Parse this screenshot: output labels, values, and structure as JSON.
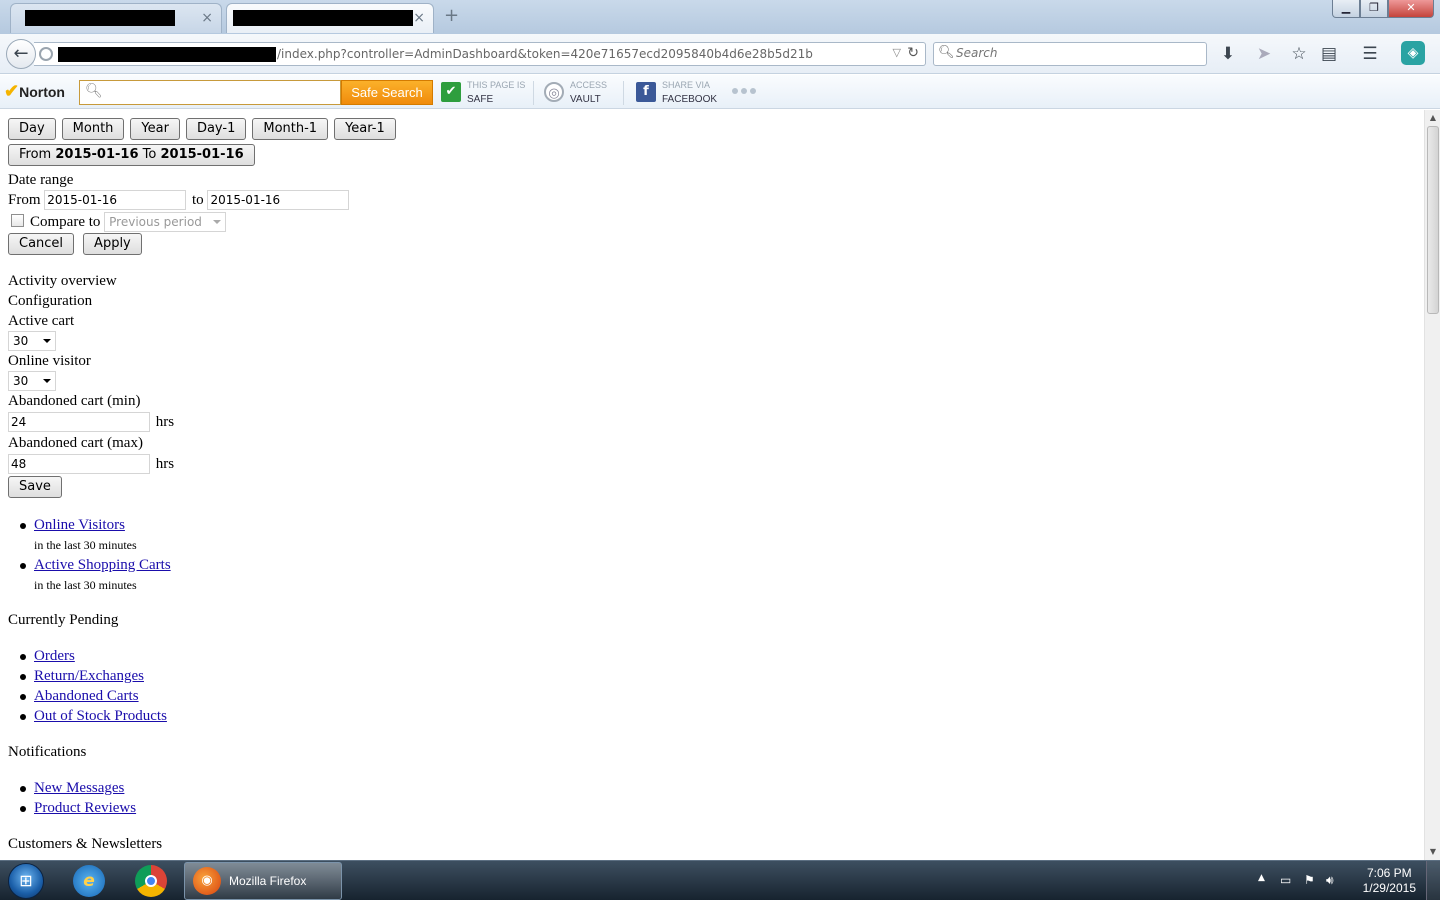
{
  "browser": {
    "tab_close": "×",
    "new_tab": "+",
    "url": "/index.php?controller=AdminDashboard&token=420e71657ecd2095840b4d6e28b5d21b",
    "search_placeholder": "Search"
  },
  "norton": {
    "logo": "Norton",
    "search_button": "Safe Search",
    "page_safe": {
      "l1": "THIS PAGE IS",
      "l2": "SAFE"
    },
    "vault": {
      "l1": "ACCESS",
      "l2": "VAULT"
    },
    "facebook": {
      "l1": "SHARE VIA",
      "l2": "FACEBOOK"
    }
  },
  "date_buttons": [
    "Day",
    "Month",
    "Year",
    "Day-1",
    "Month-1",
    "Year-1"
  ],
  "range_button": {
    "from_label": "From",
    "from": "2015-01-16",
    "to_label": "To",
    "to": "2015-01-16"
  },
  "date_range": {
    "heading": "Date range",
    "from_label": "From",
    "from_value": "2015-01-16",
    "to_label": "to",
    "to_value": "2015-01-16",
    "compare_label": "Compare to",
    "compare_option": "Previous period",
    "cancel": "Cancel",
    "apply": "Apply"
  },
  "config": {
    "activity_overview": "Activity overview",
    "configuration": "Configuration",
    "active_cart_label": "Active cart",
    "active_cart_value": "30",
    "online_visitor_label": "Online visitor",
    "online_visitor_value": "30",
    "abandoned_min_label": "Abandoned cart (min)",
    "abandoned_min_value": "24",
    "abandoned_max_label": "Abandoned cart (max)",
    "abandoned_max_value": "48",
    "unit": "hrs",
    "save": "Save"
  },
  "live": [
    {
      "link": "Online Visitors",
      "sub": "in the last 30 minutes"
    },
    {
      "link": "Active Shopping Carts",
      "sub": "in the last 30 minutes"
    }
  ],
  "pending": {
    "heading": "Currently Pending",
    "links": [
      "Orders",
      "Return/Exchanges",
      "Abandoned Carts",
      "Out of Stock Products"
    ]
  },
  "notifications": {
    "heading": "Notifications",
    "links": [
      "New Messages",
      "Product Reviews"
    ]
  },
  "customers_heading": "Customers & Newsletters",
  "taskbar": {
    "firefox_label": "Mozilla Firefox",
    "time": "7:06 PM",
    "date": "1/29/2015"
  }
}
